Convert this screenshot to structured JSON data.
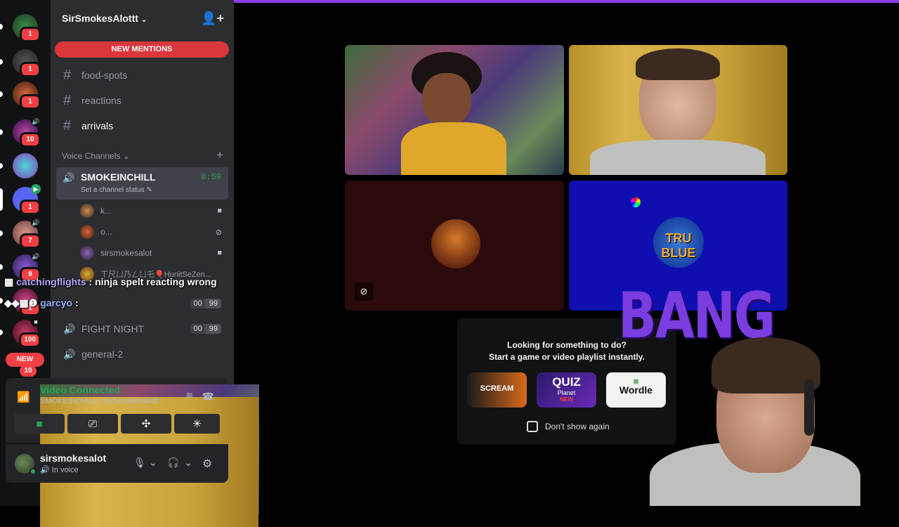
{
  "server": {
    "name": "SirSmokesAlottt",
    "new_mentions": "NEW MENTIONS"
  },
  "rail": {
    "badges": [
      "1",
      "1",
      "1",
      "10",
      "",
      "1",
      "7",
      "9",
      "1",
      "100",
      "10"
    ],
    "new_pill": "NEW"
  },
  "channels": [
    {
      "name": "food-spots"
    },
    {
      "name": "reactions"
    },
    {
      "name": "arrivals"
    }
  ],
  "voice_category": "Voice Channels",
  "active_voice": {
    "name": "SMOKEINCHILL",
    "timer": "0:59",
    "status": "Set a channel status",
    "users": [
      {
        "name": "k..."
      },
      {
        "name": "o..."
      },
      {
        "name": "sirsmokesalot"
      },
      {
        "name": "丅尺ㄩ乃ㄥㄩ乇🎈HunitSeZen..."
      }
    ]
  },
  "other_voice": [
    {
      "name": "FIGHT NIGHT",
      "count": "00",
      "limit": "99"
    },
    {
      "name": "general-2"
    }
  ],
  "hidden_voice_count": {
    "count": "00",
    "limit": "99"
  },
  "chat_overlay": [
    {
      "user": "catchingflights",
      "message": ": ninja spelt reacting wrong"
    },
    {
      "user": "garcyo",
      "message": ":"
    }
  ],
  "rtc": {
    "title": "Video Connected",
    "subtitle": "SMOKEINCHILL / SirSmokesAlottt"
  },
  "user_panel": {
    "name": "sirsmokesalot",
    "status": "In voice"
  },
  "activity": {
    "line1": "Looking for something to do?",
    "line2": "Start a game or video playlist instantly.",
    "cards": [
      "SCREAM",
      "QUIZ",
      "Wordle"
    ],
    "quiz_sub": "Planet",
    "quiz_tag": "NEW",
    "dont_show": "Don't show again"
  },
  "tiles": {
    "tile4_logo": "TRU BLUE"
  },
  "overlay_text": "BANG",
  "colors": {
    "accent": "#8a3cf2",
    "online": "#23a55a",
    "danger": "#da373c",
    "panel": "#2b2d31",
    "rail": "#111214"
  }
}
